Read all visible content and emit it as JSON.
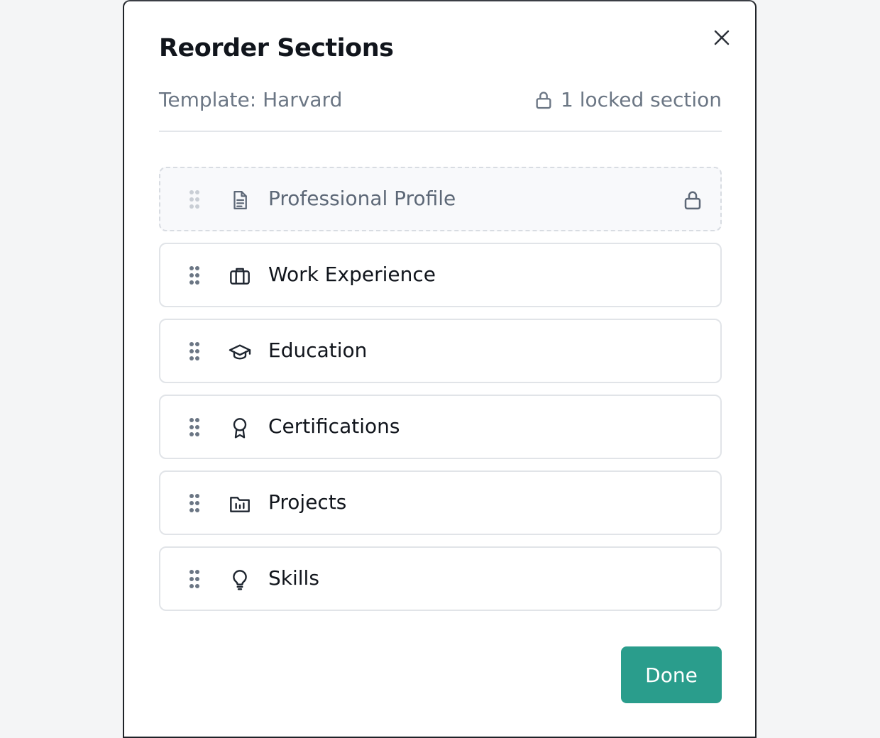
{
  "modal": {
    "title": "Reorder Sections",
    "template_label": "Template: Harvard",
    "locked_count_label": "1 locked section",
    "done_label": "Done"
  },
  "sections": [
    {
      "label": "Professional Profile",
      "icon": "document-icon",
      "locked": true
    },
    {
      "label": "Work Experience",
      "icon": "briefcase-icon",
      "locked": false
    },
    {
      "label": "Education",
      "icon": "graduation-cap-icon",
      "locked": false
    },
    {
      "label": "Certifications",
      "icon": "award-ribbon-icon",
      "locked": false
    },
    {
      "label": "Projects",
      "icon": "folder-chart-icon",
      "locked": false
    },
    {
      "label": "Skills",
      "icon": "lightbulb-icon",
      "locked": false
    }
  ],
  "colors": {
    "accent": "#2a9d8c",
    "text_primary": "#11151c",
    "text_muted": "#6b7684",
    "border": "#e1e4e8"
  }
}
